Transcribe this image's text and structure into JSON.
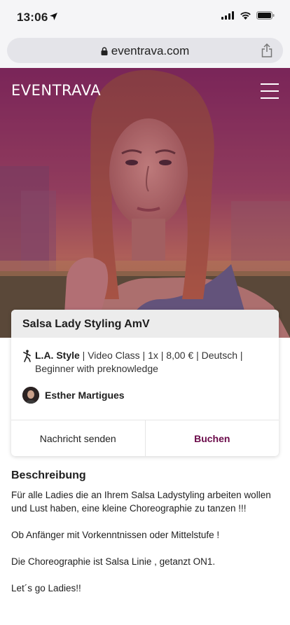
{
  "status_bar": {
    "time": "13:06"
  },
  "browser": {
    "url": "eventrava.com"
  },
  "header": {
    "logo": "EVENTRAVA"
  },
  "event": {
    "title": "Salsa Lady Styling AmV",
    "style": "L.A. Style",
    "details": " | Video Class | 1x | 8,00 € | Deutsch | Beginner with preknowledge",
    "teacher": "Esther Martigues",
    "message_button": "Nachricht senden",
    "book_button": "Buchen"
  },
  "description": {
    "title": "Beschreibung",
    "paragraphs": [
      "Für alle Ladies die an Ihrem Salsa Ladystyling arbeiten wollen und Lust haben, eine kleine Choreographie zu tanzen !!!",
      "Ob Anfänger mit Vorkenntnissen oder Mittelstufe !",
      "Die Choreographie ist Salsa Linie , getanzt ON1.",
      "Let´s go Ladies!!"
    ]
  },
  "colors": {
    "accent": "#6b0b4a",
    "hero_tint": "#8a2a5c"
  }
}
